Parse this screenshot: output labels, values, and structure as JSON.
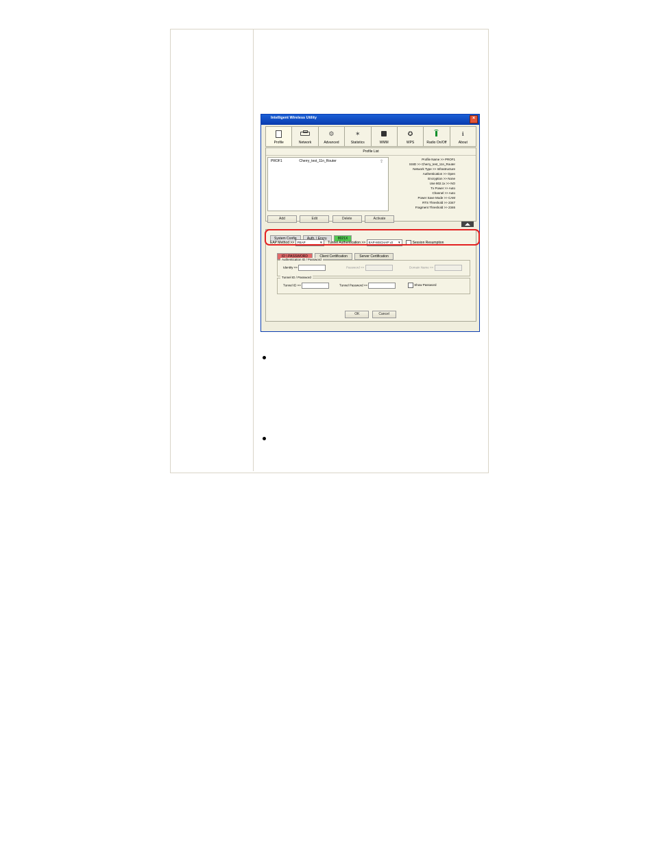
{
  "window": {
    "title": "Intelligent Wireless Utility",
    "toolbar": [
      {
        "label": "Profile",
        "name": "tab-profile",
        "active": true
      },
      {
        "label": "Network",
        "name": "tab-network"
      },
      {
        "label": "Advanced",
        "name": "tab-advanced"
      },
      {
        "label": "Statistics",
        "name": "tab-statistics"
      },
      {
        "label": "WMM",
        "name": "tab-wmm"
      },
      {
        "label": "WPS",
        "name": "tab-wps"
      },
      {
        "label": "Radio On/Off",
        "name": "tab-radio-onoff"
      },
      {
        "label": "About",
        "name": "tab-about"
      }
    ]
  },
  "profile_list": {
    "header": "Profile List",
    "row": {
      "name": "PROF1",
      "ssid": "Cherry_test_11n_Router"
    },
    "details": {
      "profile_name": "Profile Name >> PROF1",
      "ssid": "SSID >> Cherry_test_11n_Router",
      "network_type": "Network Type >> Infrastructure",
      "auth": "Authentication >> Open",
      "encrypt": "Encryption >> None",
      "use8021x": "Use 802.1x >> NO",
      "txpower": "Tx Power >> Auto",
      "channel": "Channel >> Auto",
      "psm": "Power Save Mode >> CAM",
      "rts": "RTS Threshold >> 2347",
      "frag": "Fragment Threshold >> 2346"
    },
    "buttons": {
      "add": "Add",
      "edit": "Edit",
      "del": "Delete",
      "activate": "Activate"
    }
  },
  "config": {
    "tabs": {
      "system": "System Config",
      "auth": "Auth. \\ Encry.",
      "eight021x": "8021X"
    },
    "row1": {
      "eap_method_lbl": "EAP Method >>",
      "eap_method_val": "PEAP",
      "tunnel_auth_lbl": "Tunnel Authentication >>",
      "tunnel_auth_val": "EAP-MSCHAP v2",
      "session_resume": "Session Resumption"
    },
    "subtabs": {
      "idpass": "ID \\ PASSWORD",
      "clientcert": "Client Certification",
      "servercert": "Server Certification"
    },
    "auth_group": {
      "legend": "Authentication ID / Password",
      "identity_lbl": "Identity >>",
      "password_lbl": "Password >>",
      "domain_lbl": "Domain Name >>"
    },
    "tunnel_group": {
      "legend": "Tunnel ID / Password",
      "tunnel_id_lbl": "Tunnel ID >>",
      "tunnel_pw_lbl": "Tunnel Password >>",
      "show_pw": "Show Password"
    },
    "ok": "OK",
    "cancel": "Cancel"
  }
}
